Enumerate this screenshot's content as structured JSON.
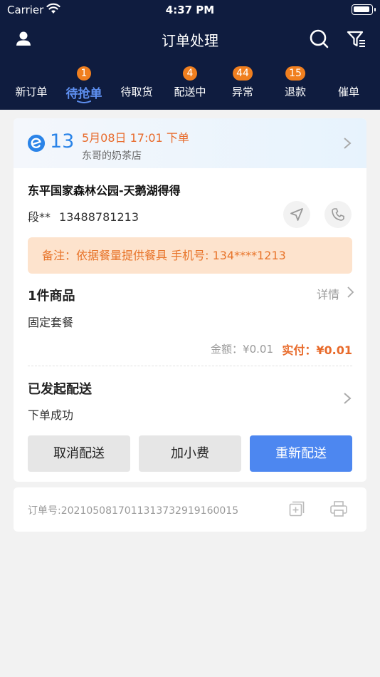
{
  "status_bar": {
    "carrier": "Carrier",
    "time": "4:37 PM"
  },
  "header": {
    "title": "订单处理",
    "icons": [
      "user-icon",
      "search-icon",
      "filter-icon"
    ]
  },
  "tabs": [
    {
      "label": "新订单",
      "badge": ""
    },
    {
      "label": "待抢单",
      "badge": "1",
      "active": true
    },
    {
      "label": "待取货",
      "badge": ""
    },
    {
      "label": "配送中",
      "badge": "4"
    },
    {
      "label": "异常",
      "badge": "44"
    },
    {
      "label": "退款",
      "badge": "15"
    },
    {
      "label": "催单",
      "badge": ""
    }
  ],
  "order": {
    "number": "13",
    "time": "5月08日 17:01 下单",
    "shop": "东哥的奶茶店",
    "address": "东平国家森林公园-天鹅湖得得",
    "customer_name": "段**",
    "customer_phone": "13488781213",
    "remark": "备注：依据餐量提供餐具 手机号: 134****1213",
    "goods_title": "1件商品",
    "details_label": "详情",
    "goods_item": "固定套餐",
    "amount": "金额：¥0.01",
    "paid": "实付：¥0.01",
    "delivery_title": "已发起配送",
    "delivery_status": "下单成功",
    "buttons": {
      "cancel": "取消配送",
      "tip": "加小费",
      "redeliver": "重新配送"
    },
    "order_id": "订单号:2021050817011313732919160015"
  },
  "colors": {
    "header_bg": "#0f1c3f",
    "active_tab": "#5e8ff0",
    "badge": "#f07f1f",
    "accent_orange": "#e86a2a",
    "primary_button": "#4d87f0"
  }
}
